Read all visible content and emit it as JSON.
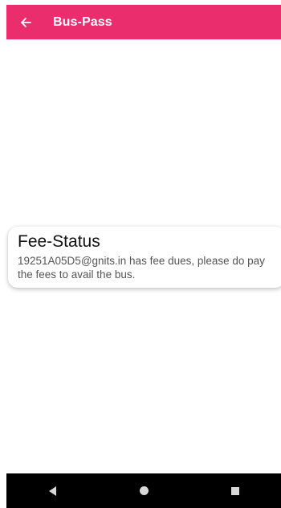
{
  "app_bar": {
    "title": "Bus-Pass",
    "back_icon": "arrow-left-icon",
    "color": "#ea2d6c"
  },
  "card": {
    "title": "Fee-Status",
    "message": "19251A05D5@gnits.in has fee dues, please do pay the fees to avail the bus."
  },
  "nav_bar": {
    "back_icon": "triangle-back-icon",
    "home_icon": "circle-home-icon",
    "recent_icon": "square-recents-icon"
  }
}
